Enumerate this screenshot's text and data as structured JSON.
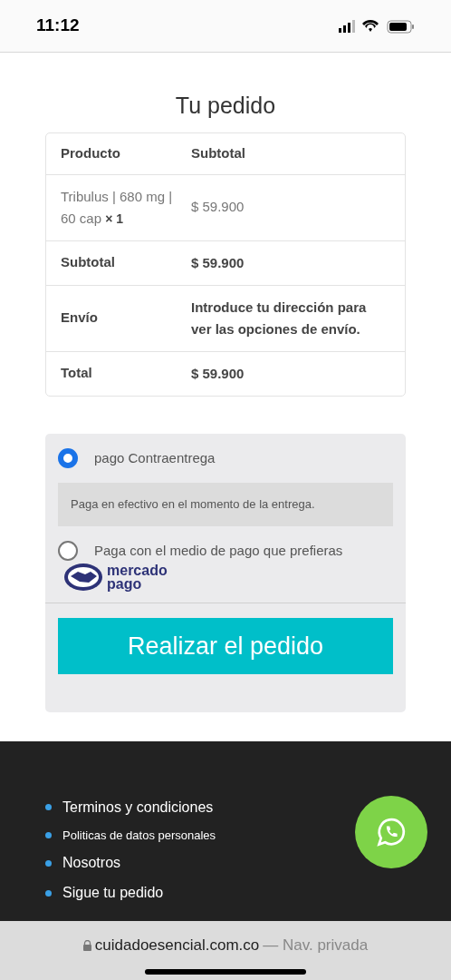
{
  "status_bar": {
    "time": "11:12"
  },
  "heading": "Tu pedido",
  "order_table": {
    "columns": [
      "Producto",
      "Subtotal"
    ],
    "rows": [
      {
        "kind": "item",
        "label": "Tribulus | 680 mg | 60 cap",
        "quantity": "× 1",
        "value": "$ 59.900"
      },
      {
        "kind": "summary",
        "label": "Subtotal",
        "value": "$ 59.900"
      },
      {
        "kind": "summary",
        "label": "Envío",
        "value": "Introduce tu dirección para ver las opciones de envío."
      },
      {
        "kind": "summary",
        "label": "Total",
        "value": "$ 59.900"
      }
    ]
  },
  "payment_methods": [
    {
      "label": "pago Contraentrega",
      "selected": true,
      "description": "Paga en efectivo en el momento de la entrega."
    },
    {
      "label": "Paga con el medio de pago que prefieras",
      "selected": false,
      "logo_text": [
        "mercado",
        "pago"
      ]
    }
  ],
  "place_order_button": "Realizar el pedido",
  "footer_links": [
    {
      "label": "Terminos y condiciones",
      "kind": "large"
    },
    {
      "label": "Politicas de datos personales",
      "kind": "small"
    },
    {
      "label": "Nosotros",
      "kind": "large"
    },
    {
      "label": "Sigue tu pedido",
      "kind": "large"
    }
  ],
  "address_bar": {
    "domain": "cuidadoesencial.com.co",
    "mode": "— Nav. privada"
  }
}
